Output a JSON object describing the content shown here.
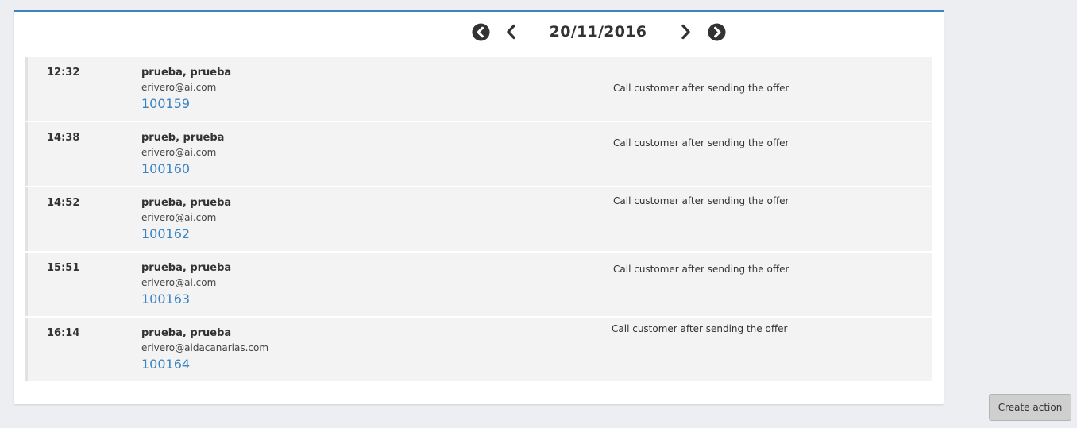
{
  "date_nav": {
    "current_date": "20/11/2016",
    "first_icon": "chevron-circle-left-icon",
    "prev_icon": "chevron-left-icon",
    "next_icon": "chevron-right-icon",
    "last_icon": "chevron-circle-right-icon"
  },
  "colors": {
    "accent": "#3c83c0",
    "item_background": "#f3f3f3",
    "page_background": "#eceef2"
  },
  "actions": [
    {
      "time": "12:32",
      "name": "prueba, prueba",
      "email": "erivero@ai.com",
      "reference": "100159",
      "note": "Call customer after sending the offer"
    },
    {
      "time": "14:38",
      "name": "prueb, prueba",
      "email": "erivero@ai.com",
      "reference": "100160",
      "note": "Call customer after sending the offer"
    },
    {
      "time": "14:52",
      "name": "prueba, prueba",
      "email": "erivero@ai.com",
      "reference": "100162",
      "note": "Call customer after sending the offer"
    },
    {
      "time": "15:51",
      "name": "prueba, prueba",
      "email": "erivero@ai.com",
      "reference": "100163",
      "note": "Call customer after sending the offer"
    },
    {
      "time": "16:14",
      "name": "prueba, prueba",
      "email": "erivero@aidacanarias.com",
      "reference": "100164",
      "note": "Call customer after sending the offer"
    }
  ],
  "footer": {
    "create_action_label": "Create action"
  }
}
